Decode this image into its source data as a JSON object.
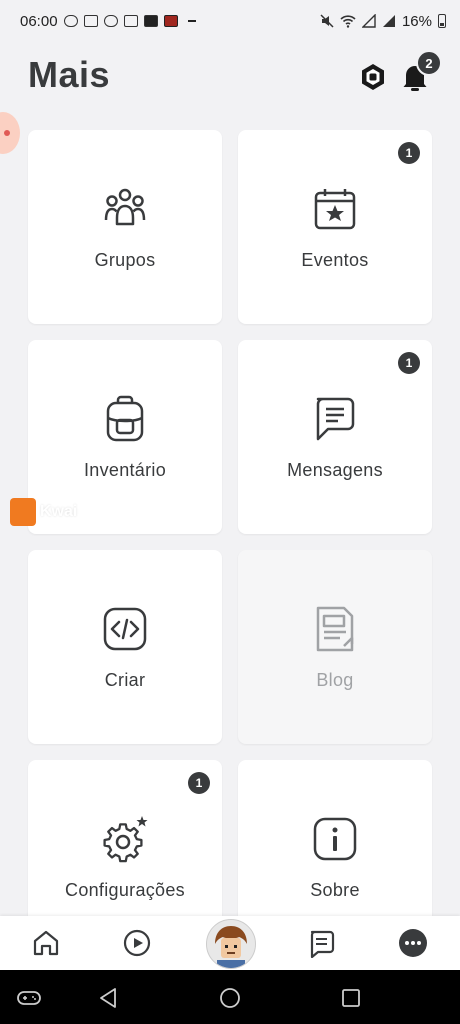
{
  "status_bar": {
    "time": "06:00",
    "battery": "16%"
  },
  "header": {
    "title": "Mais",
    "notification_count": "2"
  },
  "tiles": [
    {
      "label": "Grupos",
      "badge": ""
    },
    {
      "label": "Eventos",
      "badge": "1"
    },
    {
      "label": "Inventário",
      "badge": ""
    },
    {
      "label": "Mensagens",
      "badge": "1"
    },
    {
      "label": "Criar",
      "badge": ""
    },
    {
      "label": "Blog",
      "badge": ""
    },
    {
      "label": "Configurações",
      "badge": "1"
    },
    {
      "label": "Sobre",
      "badge": ""
    }
  ],
  "watermark": {
    "text": "Kwai"
  },
  "colors": {
    "background": "#f2f2f4",
    "tile": "#ffffff",
    "text": "#393b3d",
    "badge": "#393b3d",
    "disabled_text": "#a0a2a5"
  },
  "icons": {
    "tiles": [
      "groups-icon",
      "calendar-star-icon",
      "backpack-icon",
      "message-icon",
      "code-icon",
      "blog-icon",
      "gear-icon",
      "info-icon"
    ],
    "nav": [
      "home-icon",
      "play-icon",
      "avatar",
      "chat-icon",
      "more-icon"
    ]
  }
}
